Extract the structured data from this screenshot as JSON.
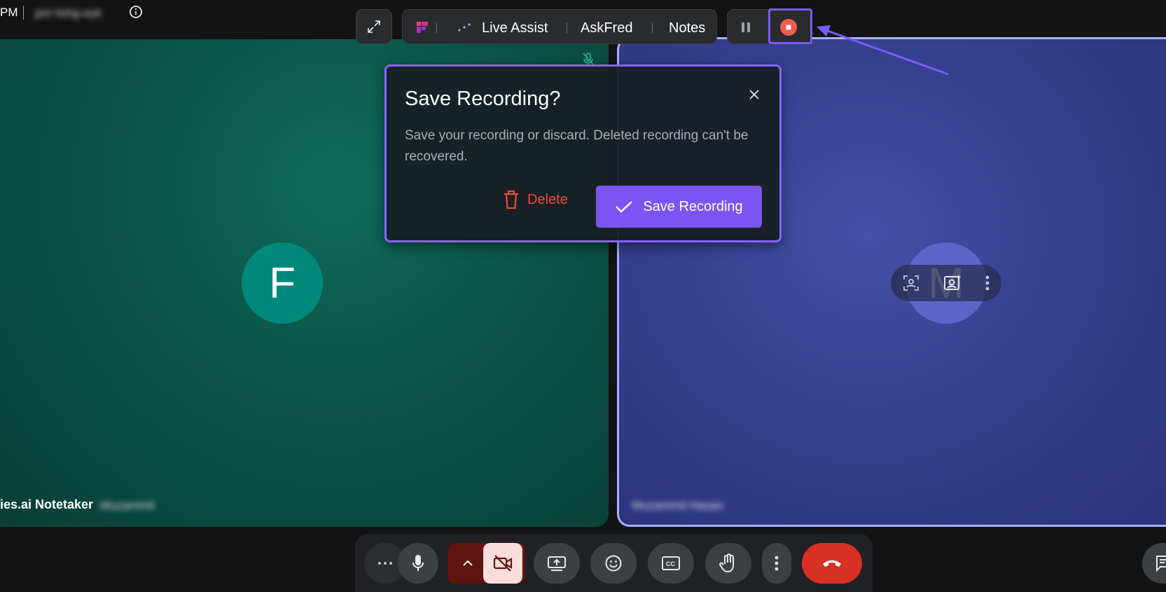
{
  "topbar": {
    "time": "PM",
    "meeting_code": "pnr-tohg-eyk"
  },
  "tiles": {
    "left": {
      "avatar_letter": "F",
      "name": "ies.ai Notetaker",
      "name_blurred": "Muzammil",
      "color": "#0b5346"
    },
    "right": {
      "avatar_letter": "M",
      "name_blurred": "Muzammil Hasan",
      "color": "#36408f"
    }
  },
  "toolbar": {
    "tools": [
      "Live Assist",
      "AskFred",
      "Notes"
    ],
    "accent": "#7b5cf5"
  },
  "dialog": {
    "title": "Save Recording?",
    "body": "Save your recording or discard. Deleted recording can't be recovered.",
    "delete_label": "Delete",
    "save_label": "Save Recording",
    "save_color": "#7a55f3",
    "delete_color": "#ef4b3c"
  },
  "controls": {
    "end_call_color": "#d93025",
    "camera_off_color": "#f9dedc"
  }
}
